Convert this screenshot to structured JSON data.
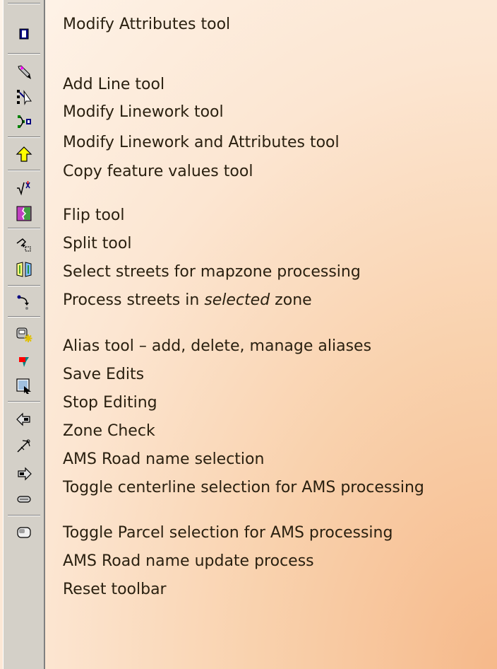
{
  "labels": {
    "modify_attributes": "Modify Attributes tool",
    "add_line": "Add Line tool",
    "modify_linework": "Modify Linework tool",
    "modify_linework_attributes": "Modify Linework and Attributes tool",
    "copy_feature_values": "Copy feature values tool",
    "flip": "Flip tool",
    "split": "Split tool",
    "select_streets": "Select streets for mapzone processing",
    "process_streets_prefix": "Process streets in ",
    "process_streets_emphasis": "selected",
    "process_streets_suffix": " zone",
    "alias": "Alias tool – add, delete, manage aliases",
    "save_edits": "Save Edits",
    "stop_editing": "Stop Editing",
    "zone_check": "Zone Check",
    "ams_road_name_selection": "AMS Road name selection",
    "toggle_centerline": "Toggle centerline selection for AMS processing",
    "toggle_parcel": "Toggle Parcel selection for AMS processing",
    "ams_road_name_update": "AMS Road name update process",
    "reset_toolbar": "Reset toolbar"
  },
  "icons": [
    "modify-attributes-icon",
    "add-line-icon",
    "modify-linework-icon",
    "modify-linework-attributes-icon",
    "copy-feature-values-icon",
    "flip-icon",
    "split-icon",
    "select-streets-icon",
    "process-streets-icon",
    "alias-icon",
    "save-edits-icon",
    "stop-editing-icon",
    "zone-check-icon",
    "ams-road-name-selection-icon",
    "toggle-centerline-icon",
    "toggle-parcel-icon",
    "ams-road-name-update-icon",
    "reset-toolbar-icon"
  ]
}
